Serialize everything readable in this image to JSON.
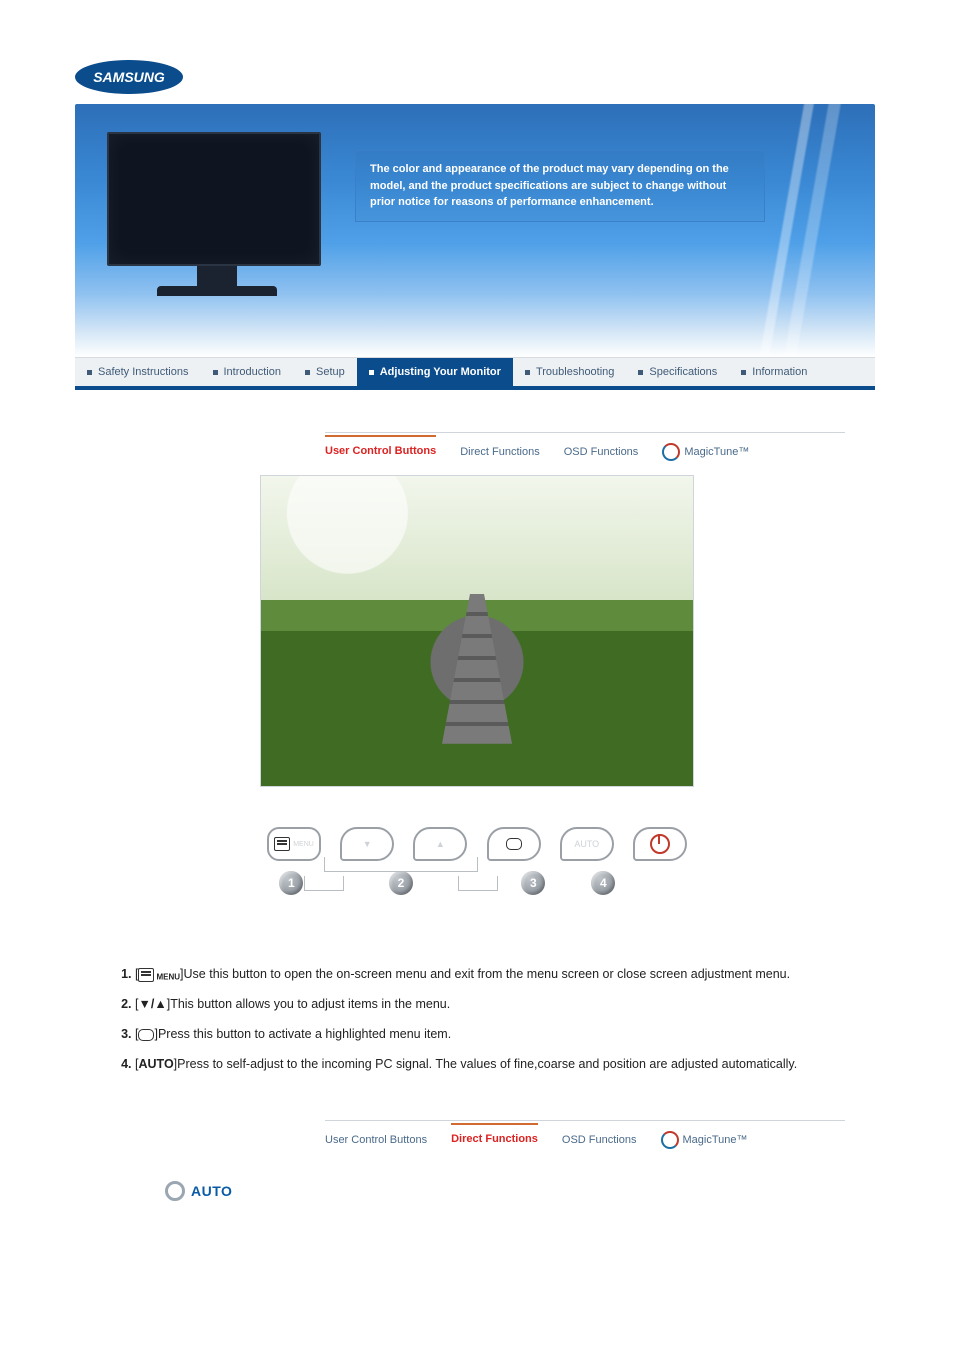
{
  "brand": "SAMSUNG",
  "hero": {
    "notice": "The color and appearance of the product may vary depending on the model, and the product specifications are subject to change without prior notice for reasons of performance enhancement."
  },
  "nav": {
    "items": [
      {
        "label": "Safety Instructions",
        "active": false
      },
      {
        "label": "Introduction",
        "active": false
      },
      {
        "label": "Setup",
        "active": false
      },
      {
        "label": "Adjusting Your Monitor",
        "active": true
      },
      {
        "label": "Troubleshooting",
        "active": false
      },
      {
        "label": "Specifications",
        "active": false
      },
      {
        "label": "Information",
        "active": false
      }
    ]
  },
  "subnav1": {
    "items": [
      {
        "label": "User Control Buttons",
        "active": true
      },
      {
        "label": "Direct Functions",
        "active": false
      },
      {
        "label": "OSD Functions",
        "active": false
      },
      {
        "label": "MagicTune™",
        "active": false,
        "magictune": true
      }
    ]
  },
  "hw_buttons": [
    {
      "label": "MENU",
      "name": "menu-button"
    },
    {
      "label": "▼",
      "name": "down-brightness-button"
    },
    {
      "label": "▲",
      "name": "up-contrast-button"
    },
    {
      "label": "↵",
      "name": "enter-button"
    },
    {
      "label": "AUTO",
      "name": "auto-button"
    },
    {
      "label": "⏻",
      "name": "power-button"
    }
  ],
  "hw_numbers": [
    "1",
    "2",
    "3",
    "4"
  ],
  "instructions": [
    {
      "prefix_icon": "menu",
      "prefix_sub": "MENU",
      "text": "Use this button to open the on-screen menu and exit from the menu screen or close screen adjustment menu."
    },
    {
      "prefix_icon": "arrows",
      "text": "This button allows you to adjust items in the menu."
    },
    {
      "prefix_icon": "enter",
      "text": "Press this button to activate a highlighted menu item."
    },
    {
      "prefix_bold": "AUTO",
      "text": "Press to self-adjust to the incoming PC signal. The values of fine,coarse and position are adjusted automatically."
    }
  ],
  "subnav2": {
    "items": [
      {
        "label": "User Control Buttons",
        "active": false
      },
      {
        "label": "Direct Functions",
        "active": true
      },
      {
        "label": "OSD Functions",
        "active": false
      },
      {
        "label": "MagicTune™",
        "active": false,
        "magictune": true
      }
    ]
  },
  "section": {
    "title": "AUTO"
  }
}
